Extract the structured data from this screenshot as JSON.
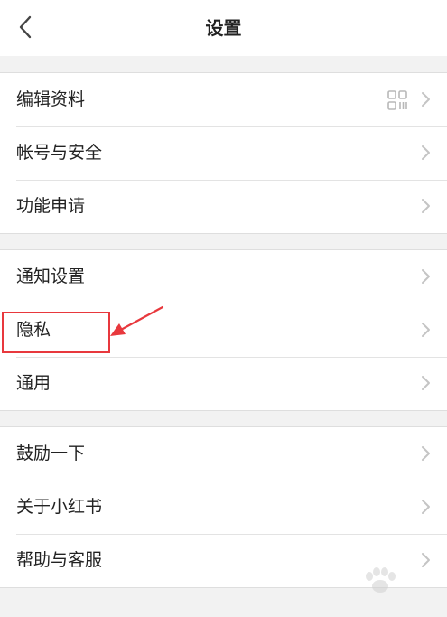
{
  "header": {
    "title": "设置"
  },
  "groups": [
    {
      "items": [
        {
          "label": "编辑资料",
          "has_qr": true
        },
        {
          "label": "帐号与安全"
        },
        {
          "label": "功能申请"
        }
      ]
    },
    {
      "items": [
        {
          "label": "通知设置"
        },
        {
          "label": "隐私",
          "highlighted": true
        },
        {
          "label": "通用"
        }
      ]
    },
    {
      "items": [
        {
          "label": "鼓励一下"
        },
        {
          "label": "关于小红书"
        },
        {
          "label": "帮助与客服"
        }
      ]
    }
  ],
  "colors": {
    "background": "#f2f2f2",
    "surface": "#ffffff",
    "text": "#222222",
    "chevron": "#c4c4c4",
    "annotation": "#e8383d"
  },
  "icons": {
    "back": "chevron-left-icon",
    "row_arrow": "chevron-right-icon",
    "qr": "qr-code-icon",
    "annotation_arrow": "arrow-annotation-icon"
  }
}
